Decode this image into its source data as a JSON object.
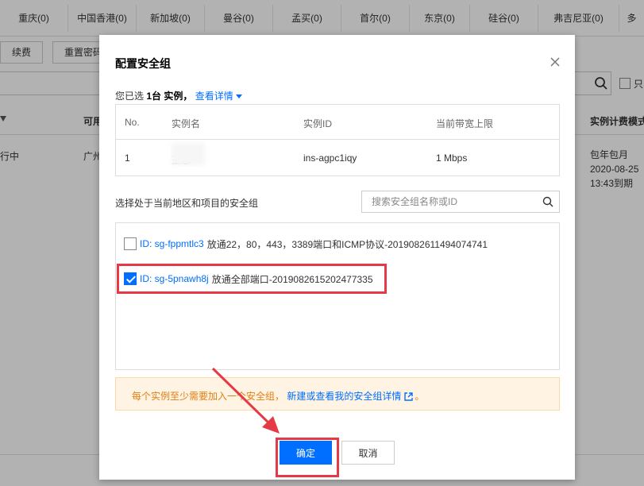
{
  "regions": [
    {
      "label": "重庆(0)"
    },
    {
      "label": "中国香港(0)"
    },
    {
      "label": "新加坡(0)"
    },
    {
      "label": "曼谷(0)"
    },
    {
      "label": "孟买(0)"
    },
    {
      "label": "首尔(0)"
    },
    {
      "label": "东京(0)"
    },
    {
      "label": "硅谷(0)"
    },
    {
      "label": "弗吉尼亚(0)"
    },
    {
      "label": "多"
    }
  ],
  "toolbar": {
    "renew_label": "续费",
    "reset_password_label": "重置密码"
  },
  "filter": {
    "only_label": "只"
  },
  "background_table": {
    "headers": {
      "col_available": "可用",
      "col_billing": "实例计费模式"
    },
    "row": {
      "status_partial": "行中",
      "zone_partial": "广州",
      "billing_mode": "包年包月",
      "expire_date": "2020-08-25",
      "expire_time": "13:43到期"
    }
  },
  "modal": {
    "title": "配置安全组",
    "selected_prefix": "您已选",
    "selected_count": "1台",
    "selected_suffix": "实例，",
    "view_details_link": "查看详情",
    "instance_table": {
      "headers": {
        "no": "No.",
        "name": "实例名",
        "id": "实例ID",
        "bandwidth": "当前带宽上限"
      },
      "rows": [
        {
          "no": "1",
          "name": "王忠",
          "id": "ins-agpc1iqy",
          "bandwidth": "1 Mbps"
        }
      ]
    },
    "choose_label": "选择处于当前地区和项目的安全组",
    "search_placeholder": "搜索安全组名称或ID",
    "security_groups": [
      {
        "id_text": "ID: sg-fppmtlc3",
        "desc": "放通22，80，443，3389端口和ICMP协议-20190826114940747​41",
        "checked": false
      },
      {
        "id_text": "ID: sg-5pnawh8j",
        "desc": "放通全部端口-20190826152024​77335",
        "checked": true
      }
    ],
    "warning": {
      "text": "每个实例至少需要加入一个安全组，",
      "link": "新建或查看我的安全组详情",
      "end": "。"
    },
    "ok_label": "确定",
    "cancel_label": "取消"
  },
  "colors": {
    "primary": "#006eff",
    "highlight": "#e63946",
    "warning_bg": "#fff4e3",
    "warning_text": "#e27e13"
  }
}
